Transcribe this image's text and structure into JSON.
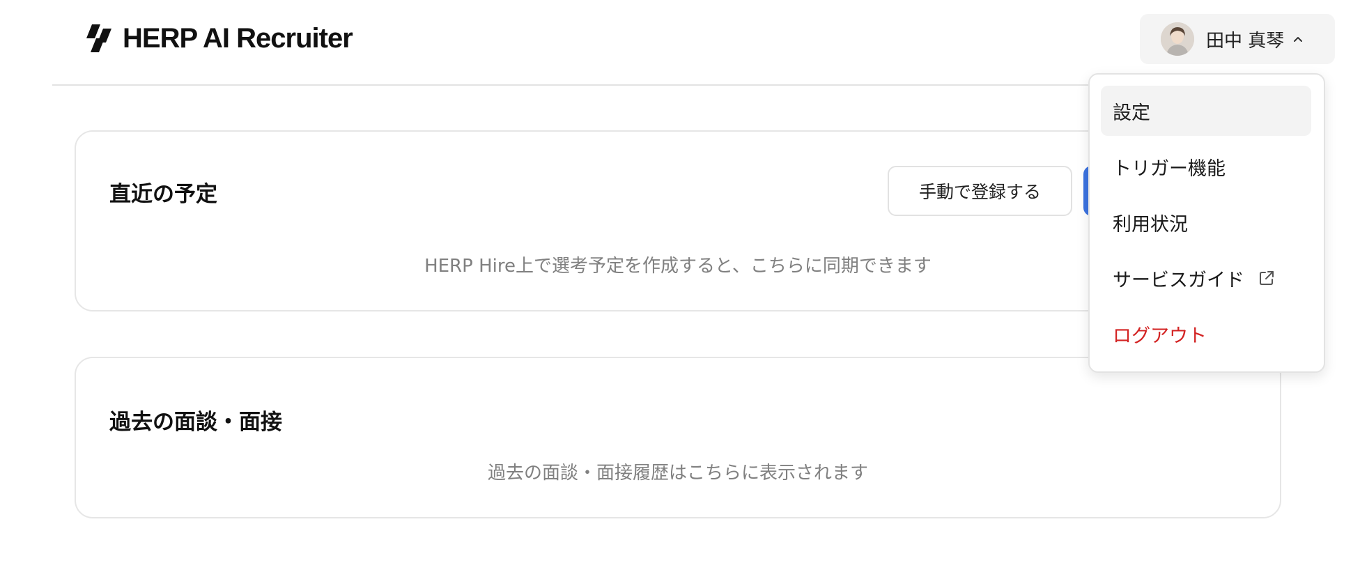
{
  "header": {
    "app_name": "HERP AI Recruiter",
    "user_name": "田中 真琴"
  },
  "upcoming": {
    "title": "直近の予定",
    "manual_button_label": "手動で登録する",
    "empty_message": "HERP Hire上で選考予定を作成すると、こちらに同期できます"
  },
  "past": {
    "title": "過去の面談・面接",
    "empty_message": "過去の面談・面接履歴はこちらに表示されます"
  },
  "user_menu": {
    "items": [
      {
        "label": "設定"
      },
      {
        "label": "トリガー機能"
      },
      {
        "label": "利用状況"
      },
      {
        "label": "サービスガイド"
      },
      {
        "label": "ログアウト"
      }
    ]
  },
  "colors": {
    "primary": "#3c73e0",
    "danger": "#d32323",
    "muted_text": "#808080"
  }
}
